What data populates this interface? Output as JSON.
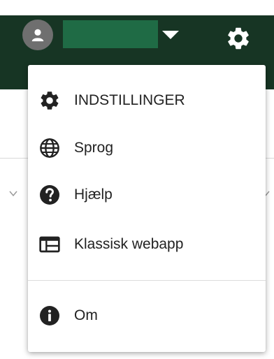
{
  "header": {
    "user_menu_caret": "chevron-down-icon",
    "settings_icon": "gear-icon",
    "avatar_icon": "user-avatar-icon"
  },
  "menu": {
    "items": [
      {
        "label": "INDSTILLINGER",
        "icon": "gear-icon"
      },
      {
        "label": "Sprog",
        "icon": "globe-icon"
      },
      {
        "label": "Hjælp",
        "icon": "help-circle-icon"
      },
      {
        "label": "Klassisk webapp",
        "icon": "web-window-icon"
      },
      {
        "label": "Om",
        "icon": "info-circle-icon"
      }
    ]
  },
  "colors": {
    "header_bg": "#173524",
    "username_mask": "#1f6b45",
    "icon": "#222222"
  }
}
